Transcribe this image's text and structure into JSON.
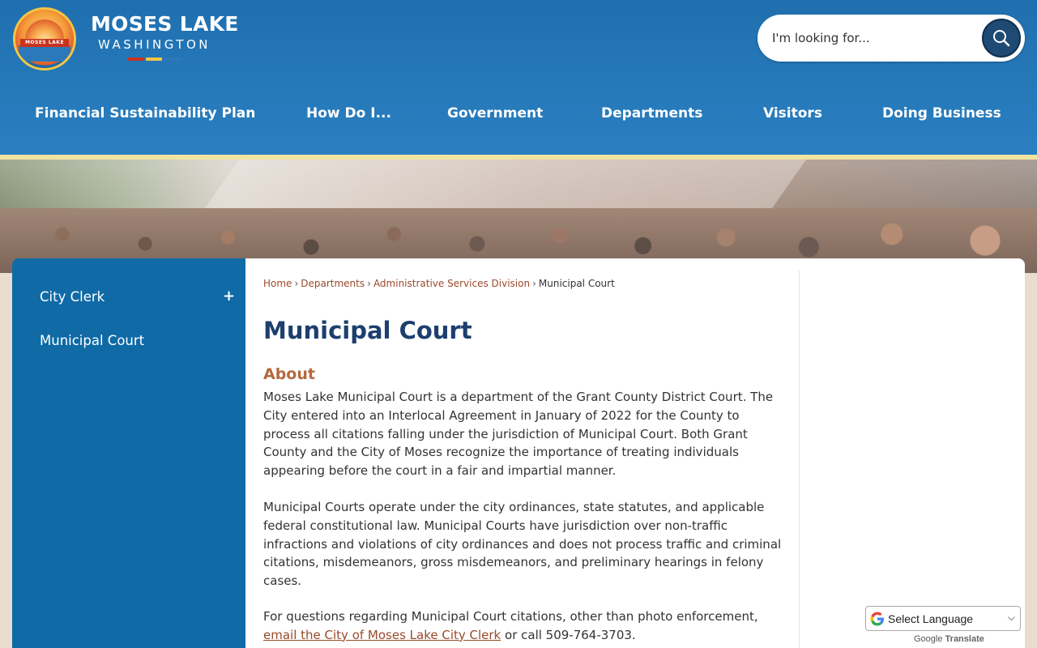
{
  "header": {
    "brand_name": "MOSES LAKE",
    "brand_sub": "WASHINGTON",
    "seal_text": "MOSES LAKE",
    "bar_colors": [
      "#c8331f",
      "#f4c542",
      "#2c79b9"
    ],
    "search_placeholder": "I'm looking for..."
  },
  "nav": {
    "items": [
      {
        "label": "Financial Sustainability Plan"
      },
      {
        "label": "How Do I..."
      },
      {
        "label": "Government"
      },
      {
        "label": "Departments"
      },
      {
        "label": "Visitors"
      },
      {
        "label": "Doing Business"
      }
    ]
  },
  "sidebar": {
    "items": [
      {
        "label": "City Clerk",
        "expand": "+"
      },
      {
        "label": "Municipal Court"
      }
    ]
  },
  "breadcrumb": {
    "items": [
      "Home",
      "Departments",
      "Administrative Services Division"
    ],
    "current": "Municipal Court",
    "separator": "›"
  },
  "main": {
    "title": "Municipal Court",
    "about_heading": "About",
    "paragraph1": "Moses Lake Municipal Court is a department of the Grant County District Court.  The City entered into an Interlocal Agreement in January of 2022 for the County to process all citations falling under the jurisdiction of Municipal Court. Both Grant County and the City of Moses recognize the importance of treating individuals appearing before the court in a fair and impartial manner.",
    "paragraph2": "Municipal Courts operate under the city ordinances, state statutes, and applicable federal constitutional law. Municipal Courts have jurisdiction over non-traffic infractions and violations of city ordinances and does not process traffic and criminal citations, misdemeanors, gross misdemeanors, and preliminary hearings in felony cases.",
    "paragraph3_prefix": "For questions regarding Municipal Court citations, other than photo enforcement, ",
    "paragraph3_link": "email the City of Moses Lake City Clerk",
    "paragraph3_suffix": " or call 509-764-3703."
  },
  "translate": {
    "select_label": "Select Language",
    "credit_prefix": "Google",
    "credit_suffix": "Translate"
  },
  "colors": {
    "header_blue": "#2578b8",
    "sidebar_blue": "#0f6aa6",
    "title_navy": "#1c3f6e",
    "accent_rust": "#b5683e",
    "link_brown": "#9b4a2a"
  }
}
